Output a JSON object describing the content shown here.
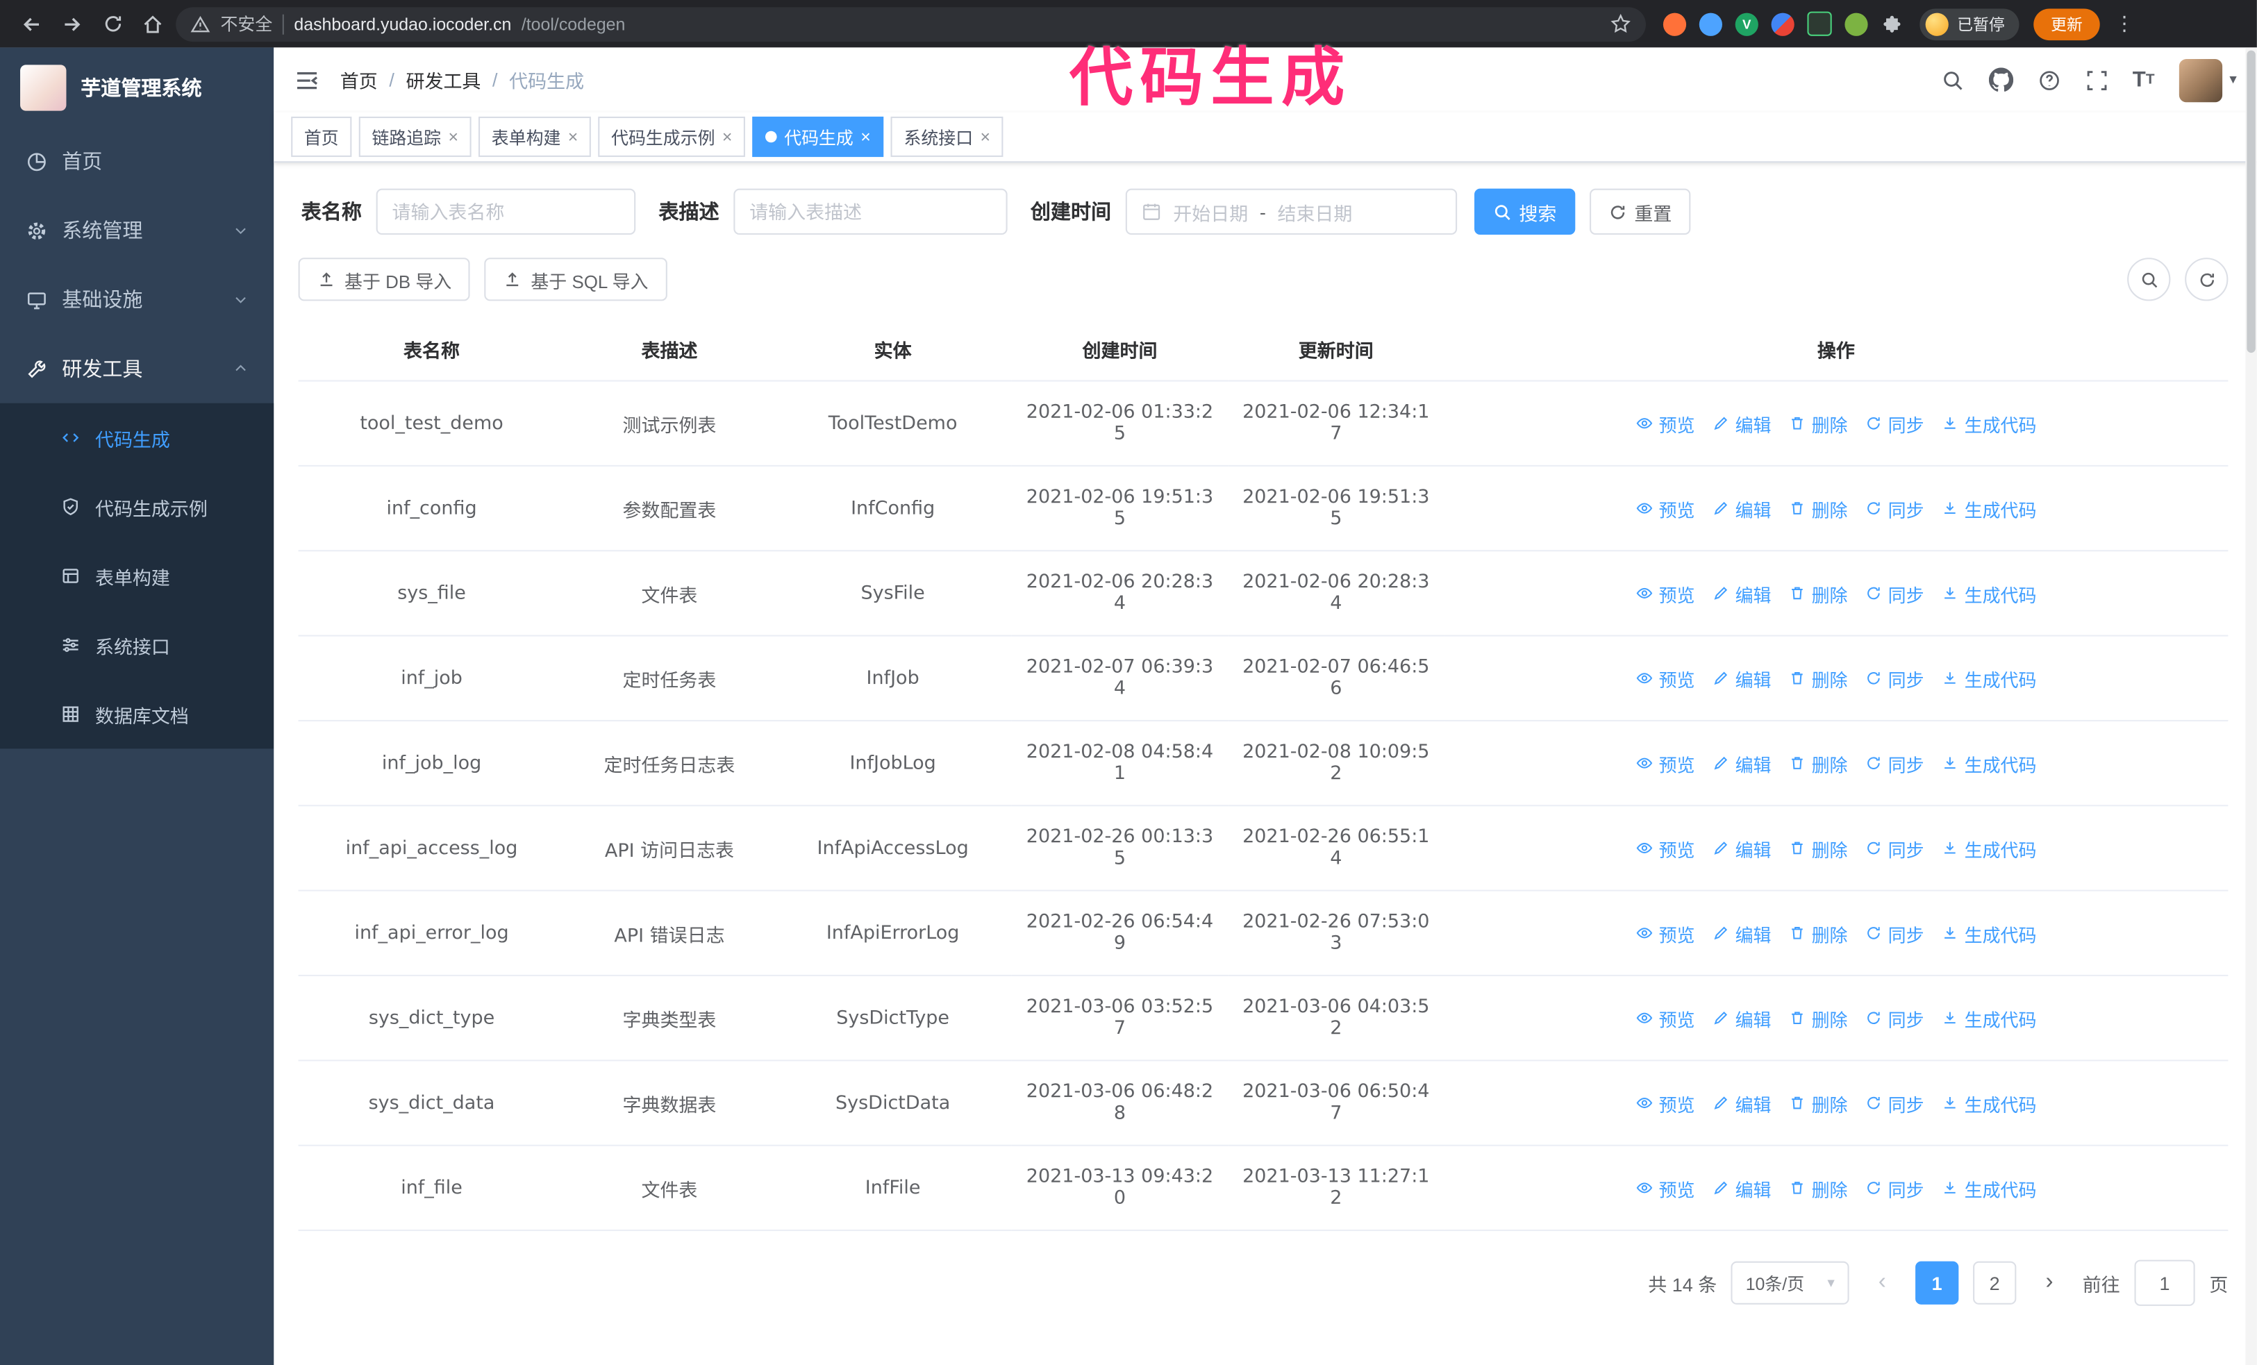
{
  "annotation": {
    "text": "代码生成",
    "color": "#ff2d78"
  },
  "theme": {
    "primary": "#409eff",
    "sidebar_bg": "#304156",
    "submenu_bg": "#1f2d3d",
    "chrome_bg": "#232428",
    "update_button_bg": "#e8710a"
  },
  "browser": {
    "security_label": "不安全",
    "url_host": "dashboard.yudao.iocoder.cn",
    "url_path": "/tool/codegen",
    "profile_badge": "已暂停",
    "update_button": "更新"
  },
  "sidebar": {
    "app_title": "芋道管理系统",
    "items": [
      {
        "label": "首页",
        "icon": "dashboard-icon"
      },
      {
        "label": "系统管理",
        "icon": "gear-icon",
        "chevron": "down"
      },
      {
        "label": "基础设施",
        "icon": "monitor-icon",
        "chevron": "down"
      },
      {
        "label": "研发工具",
        "icon": "tools-icon",
        "chevron": "up",
        "expanded": true
      }
    ],
    "subitems": [
      {
        "label": "代码生成",
        "icon": "code-icon",
        "active": true
      },
      {
        "label": "代码生成示例",
        "icon": "shield-check-icon"
      },
      {
        "label": "表单构建",
        "icon": "form-icon"
      },
      {
        "label": "系统接口",
        "icon": "sliders-icon"
      },
      {
        "label": "数据库文档",
        "icon": "grid-icon"
      }
    ]
  },
  "breadcrumb": {
    "items": [
      "首页",
      "研发工具",
      "代码生成"
    ],
    "separator": "/"
  },
  "tabs": [
    {
      "label": "首页",
      "closable": false,
      "active": false
    },
    {
      "label": "链路追踪",
      "closable": true,
      "active": false
    },
    {
      "label": "表单构建",
      "closable": true,
      "active": false
    },
    {
      "label": "代码生成示例",
      "closable": true,
      "active": false
    },
    {
      "label": "代码生成",
      "closable": true,
      "active": true
    },
    {
      "label": "系统接口",
      "closable": true,
      "active": false
    }
  ],
  "filters": {
    "table_name_label": "表名称",
    "table_name_placeholder": "请输入表名称",
    "table_desc_label": "表描述",
    "table_desc_placeholder": "请输入表描述",
    "create_time_label": "创建时间",
    "date_start_placeholder": "开始日期",
    "date_separator": "-",
    "date_end_placeholder": "结束日期",
    "search_button": "搜索",
    "reset_button": "重置"
  },
  "toolbar": {
    "import_db_button": "基于 DB 导入",
    "import_sql_button": "基于 SQL 导入"
  },
  "table": {
    "columns": [
      "表名称",
      "表描述",
      "实体",
      "创建时间",
      "更新时间",
      "操作"
    ],
    "action_labels": [
      "预览",
      "编辑",
      "删除",
      "同步",
      "生成代码"
    ],
    "rows": [
      {
        "name": "tool_test_demo",
        "desc": "测试示例表",
        "entity": "ToolTestDemo",
        "created": "2021-02-06 01:33:25",
        "updated": "2021-02-06 12:34:17"
      },
      {
        "name": "inf_config",
        "desc": "参数配置表",
        "entity": "InfConfig",
        "created": "2021-02-06 19:51:35",
        "updated": "2021-02-06 19:51:35"
      },
      {
        "name": "sys_file",
        "desc": "文件表",
        "entity": "SysFile",
        "created": "2021-02-06 20:28:34",
        "updated": "2021-02-06 20:28:34"
      },
      {
        "name": "inf_job",
        "desc": "定时任务表",
        "entity": "InfJob",
        "created": "2021-02-07 06:39:34",
        "updated": "2021-02-07 06:46:56"
      },
      {
        "name": "inf_job_log",
        "desc": "定时任务日志表",
        "entity": "InfJobLog",
        "created": "2021-02-08 04:58:41",
        "updated": "2021-02-08 10:09:52"
      },
      {
        "name": "inf_api_access_log",
        "desc": "API 访问日志表",
        "entity": "InfApiAccessLog",
        "created": "2021-02-26 00:13:35",
        "updated": "2021-02-26 06:55:14"
      },
      {
        "name": "inf_api_error_log",
        "desc": "API 错误日志",
        "entity": "InfApiErrorLog",
        "created": "2021-02-26 06:54:49",
        "updated": "2021-02-26 07:53:03"
      },
      {
        "name": "sys_dict_type",
        "desc": "字典类型表",
        "entity": "SysDictType",
        "created": "2021-03-06 03:52:57",
        "updated": "2021-03-06 04:03:52"
      },
      {
        "name": "sys_dict_data",
        "desc": "字典数据表",
        "entity": "SysDictData",
        "created": "2021-03-06 06:48:28",
        "updated": "2021-03-06 06:50:47"
      },
      {
        "name": "inf_file",
        "desc": "文件表",
        "entity": "InfFile",
        "created": "2021-03-13 09:43:20",
        "updated": "2021-03-13 11:27:12"
      }
    ]
  },
  "pagination": {
    "total_text": "共 14 条",
    "page_size": "10条/页",
    "pages": [
      "1",
      "2"
    ],
    "active_page": "1",
    "goto_prefix": "前往",
    "goto_value": "1",
    "goto_suffix": "页"
  }
}
